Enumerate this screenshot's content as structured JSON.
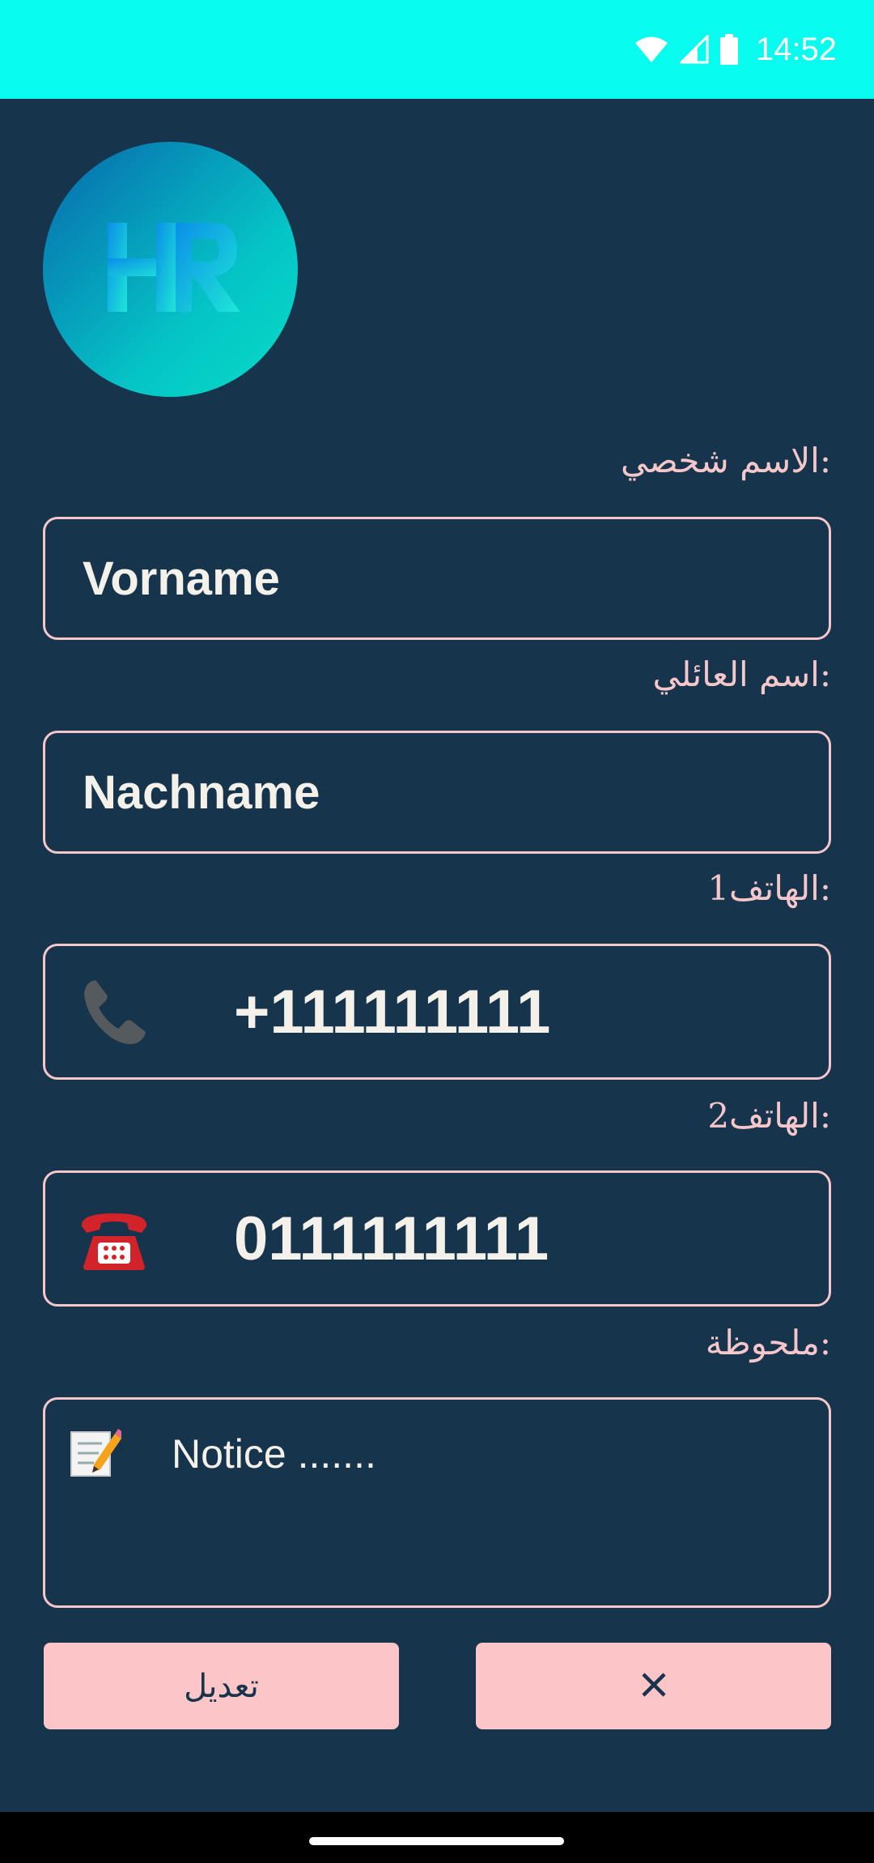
{
  "status_bar": {
    "time": "14:52",
    "icons": [
      "wifi-icon",
      "cell-signal-icon",
      "battery-icon"
    ],
    "background": "#07fbef"
  },
  "logo": {
    "text": "HR"
  },
  "form": {
    "first_name": {
      "label": ":الاسم شخصي",
      "value": "Vorname"
    },
    "last_name": {
      "label": ":اسم العائلي",
      "value": "Nachname"
    },
    "phone1": {
      "label": ":الهاتف1",
      "value": "+111111111",
      "icon": "telephone-receiver-icon"
    },
    "phone2": {
      "label": ":الهاتف2",
      "value": "0111111111",
      "icon": "telephone-icon"
    },
    "note": {
      "label": ":ملحوظة",
      "placeholder": "Notice .......",
      "icon": "memo-icon"
    }
  },
  "buttons": {
    "edit_label": "تعديل",
    "close_label": "✕"
  },
  "colors": {
    "background": "#16344c",
    "accent": "#f5c6ca",
    "button": "#fcc5c7",
    "status_bar": "#07fbef"
  }
}
